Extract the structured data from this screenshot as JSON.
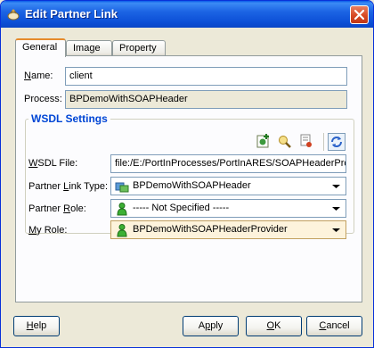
{
  "window": {
    "title": "Edit Partner Link"
  },
  "tabs": [
    {
      "label": "General"
    },
    {
      "label": "Image"
    },
    {
      "label": "Property"
    }
  ],
  "general": {
    "name_label_mnemonic": "N",
    "name_label_rest": "ame:",
    "name_value": "client",
    "process_label": "Process:",
    "process_value": "BPDemoWithSOAPHeader"
  },
  "wsdl": {
    "group_title": "WSDL Settings",
    "toolbar_icons": [
      "create-wsdl-icon",
      "browse-wsdl-icon",
      "service-explorer-icon",
      "refresh-icon"
    ],
    "file_label_mnemonic": "W",
    "file_label_rest": "SDL File:",
    "file_value": "file:/E:/PortInProcesses/PortInARES/SOAPHeaderProc",
    "link_type_label_pre": "Partner ",
    "link_type_label_mnemonic": "L",
    "link_type_label_rest": "ink Type:",
    "link_type_value": "BPDemoWithSOAPHeader",
    "partner_role_label_pre": "Partner ",
    "partner_role_label_mnemonic": "R",
    "partner_role_label_rest": "ole:",
    "partner_role_value": "----- Not Specified -----",
    "my_role_label_mnemonic": "M",
    "my_role_label_rest": "y Role:",
    "my_role_value": "BPDemoWithSOAPHeaderProvider"
  },
  "buttons": {
    "help_mnemonic": "H",
    "help_rest": "elp",
    "apply_pre": "A",
    "apply_mnemonic": "p",
    "apply_rest": "ply",
    "ok_mnemonic": "O",
    "ok_rest": "K",
    "cancel_mnemonic": "C",
    "cancel_rest": "ancel"
  },
  "colors": {
    "title_bar": "#0c4fd6",
    "group_title": "#0046d5",
    "active_tab_accent": "#e68b2c"
  }
}
